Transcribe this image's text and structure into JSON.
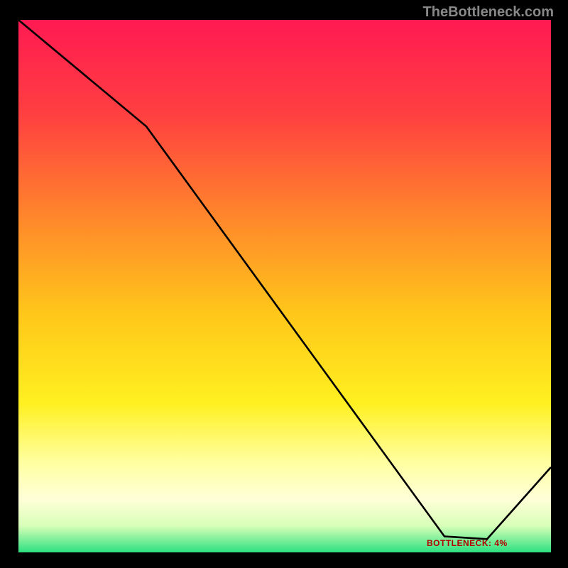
{
  "watermark": "TheBottleneck.com",
  "bottom_label": "BOTTLENECK: 4%",
  "gradient_stops": [
    {
      "offset": 0.0,
      "color": "#ff1a52"
    },
    {
      "offset": 0.18,
      "color": "#ff4040"
    },
    {
      "offset": 0.38,
      "color": "#ff8a2a"
    },
    {
      "offset": 0.55,
      "color": "#ffc61a"
    },
    {
      "offset": 0.72,
      "color": "#fff020"
    },
    {
      "offset": 0.83,
      "color": "#ffffa0"
    },
    {
      "offset": 0.9,
      "color": "#ffffd8"
    },
    {
      "offset": 0.95,
      "color": "#d8ffb8"
    },
    {
      "offset": 1.0,
      "color": "#2de080"
    }
  ],
  "chart_data": {
    "type": "line",
    "title": "",
    "xlabel": "",
    "ylabel": "",
    "xlim": [
      0,
      100
    ],
    "ylim": [
      0,
      100
    ],
    "series": [
      {
        "name": "bottleneck-curve",
        "x": [
          0,
          24,
          80,
          88,
          100
        ],
        "values": [
          100,
          80,
          3,
          2.5,
          16
        ]
      }
    ],
    "flat_segment": {
      "x_start": 80,
      "x_end": 88,
      "y": 2.8
    },
    "label_x": 84
  }
}
